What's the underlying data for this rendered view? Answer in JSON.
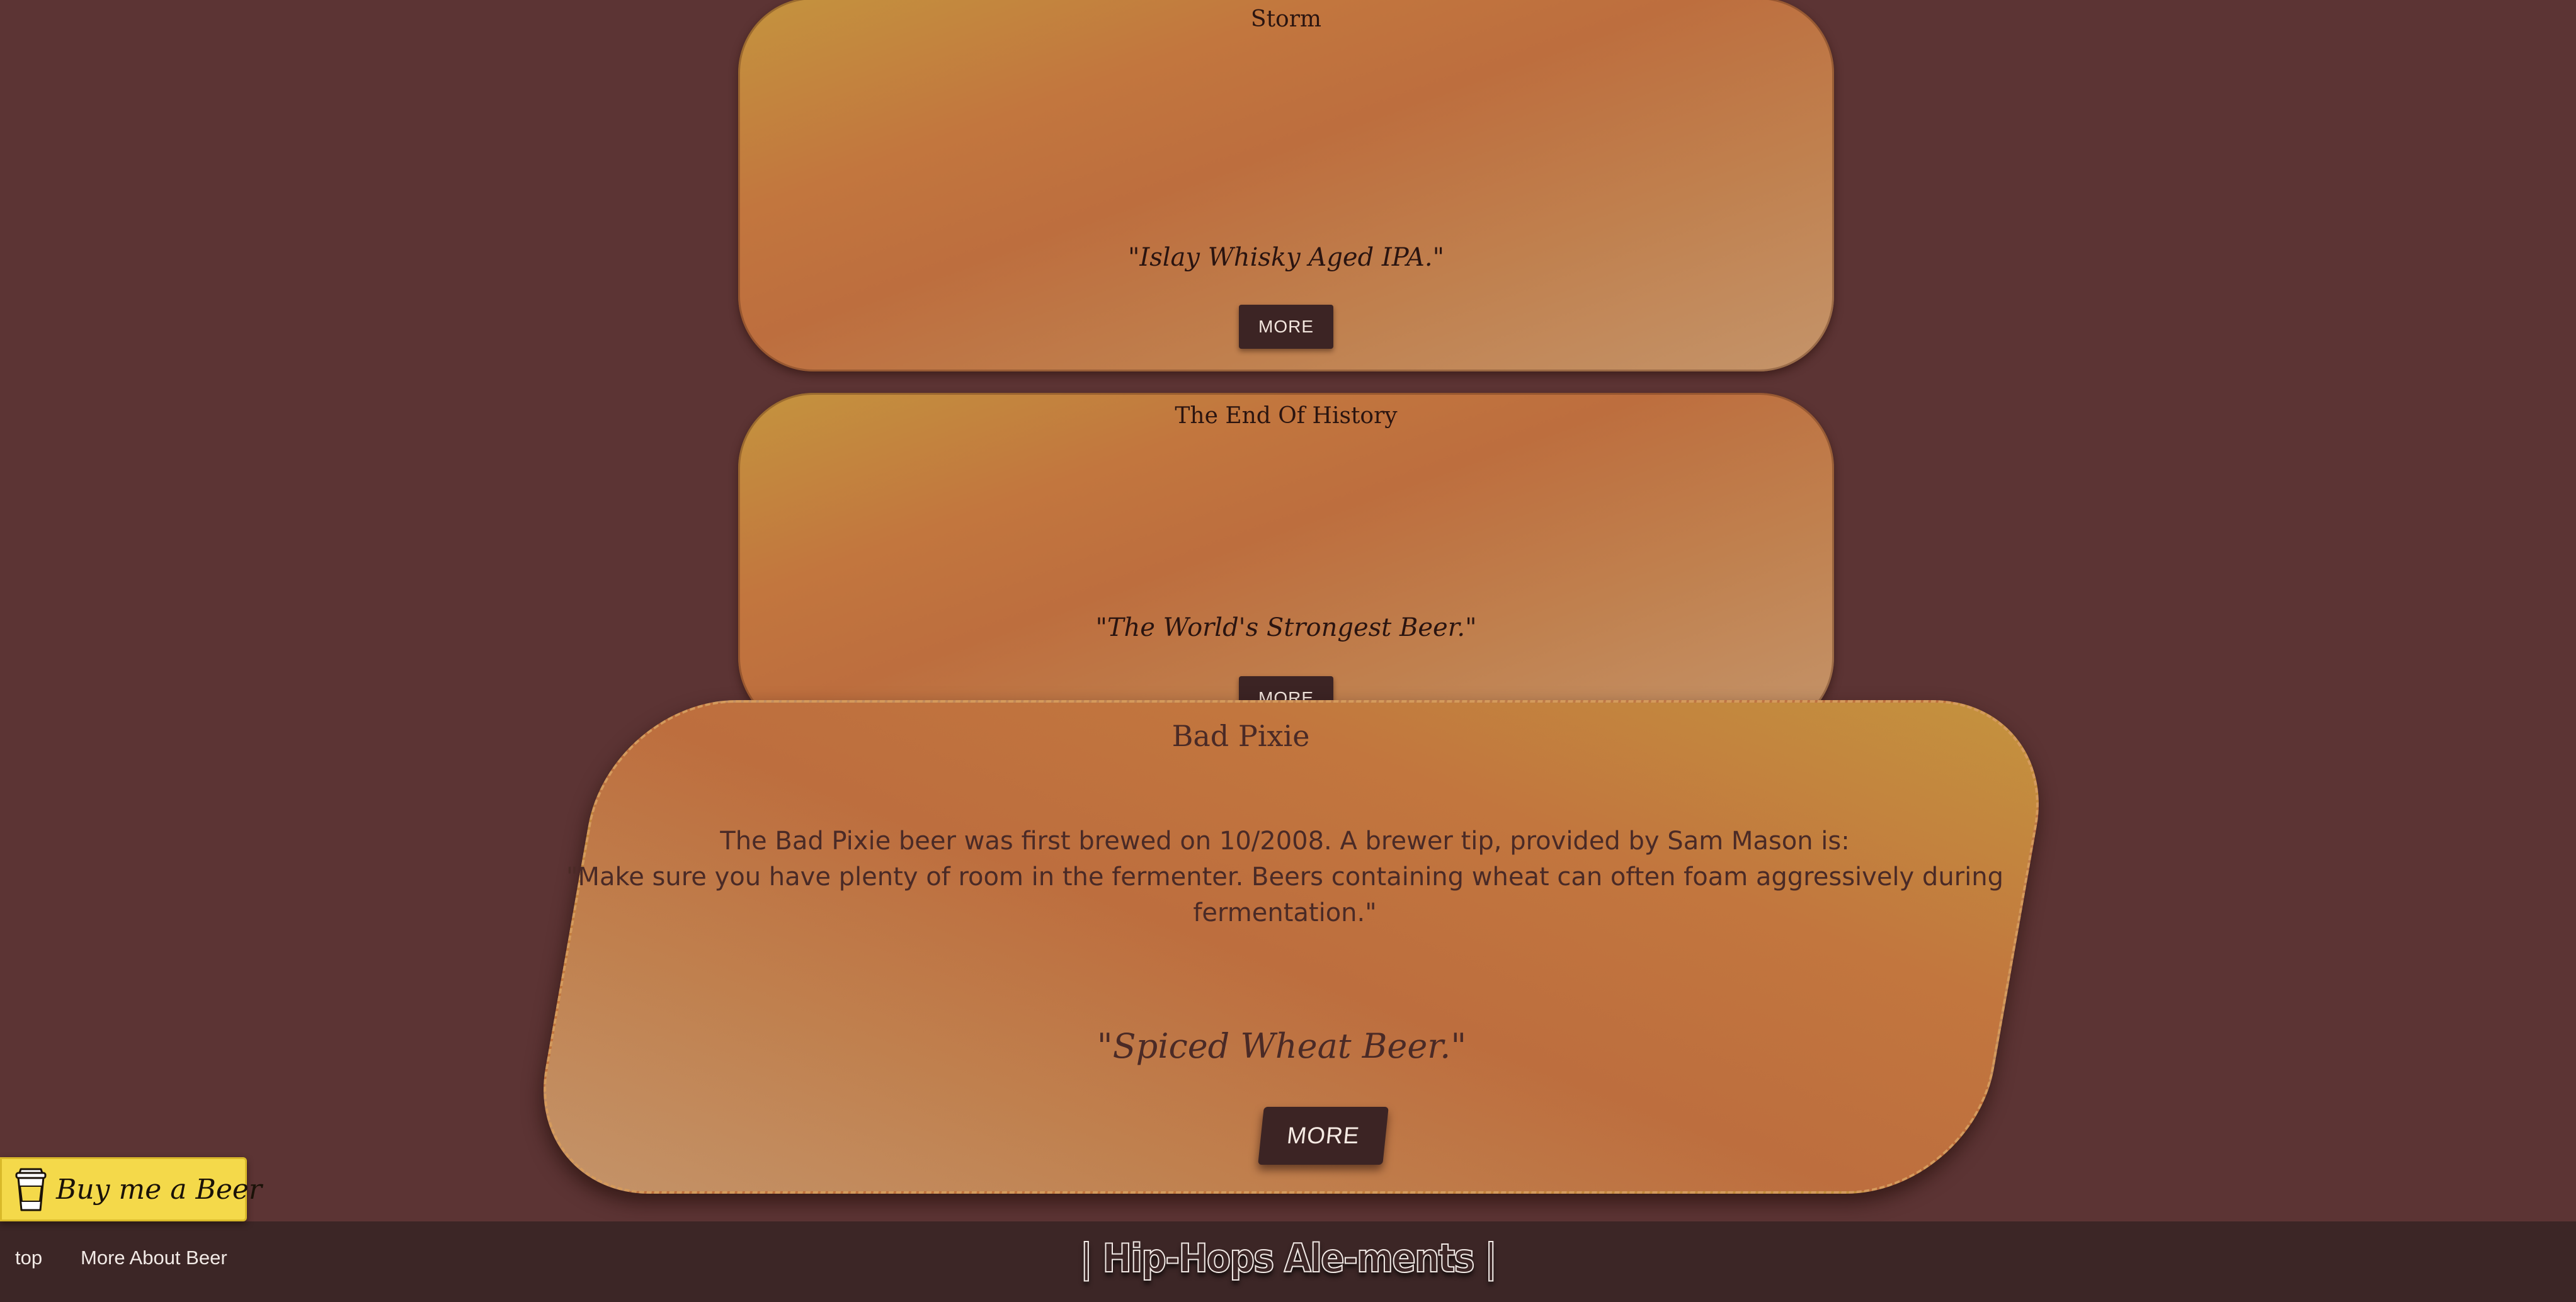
{
  "cards": [
    {
      "name": "Storm",
      "tagline": "\"Islay Whisky Aged IPA.\"",
      "button_label": "MORE"
    },
    {
      "name": "The End Of History",
      "tagline": "\"The World's Strongest Beer.\"",
      "button_label": "MORE"
    }
  ],
  "expanded_card": {
    "name": "Bad Pixie",
    "description_lines": [
      "The Bad Pixie beer was first brewed on 10/2008. A brewer tip, provided by Sam Mason is:",
      "\"Make sure you have plenty of room in the fermenter. Beers containing wheat can often foam aggressively during",
      "fermentation.\""
    ],
    "tagline": "\"Spiced Wheat Beer.\"",
    "button_label": "MORE"
  },
  "donate_button": {
    "label": "Buy me a Beer",
    "icon": "beer-cup-icon"
  },
  "footer": {
    "links": [
      "top",
      "More About Beer"
    ],
    "brand": "| Hip-Hops Ale-ments |"
  },
  "colors": {
    "background": "#5c3434",
    "card_gradient_start": "#c4943e",
    "card_gradient_mid": "#bd6e3e",
    "card_gradient_end": "#c4946a",
    "button": "#3c2424",
    "footer": "#3c2626",
    "donate": "#f4d94a"
  }
}
